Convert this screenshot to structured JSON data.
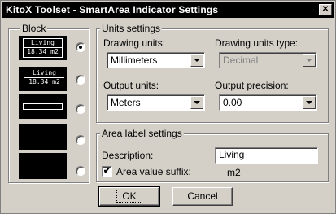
{
  "window": {
    "title": "KitoX Toolset - SmartArea Indicator Settings",
    "close_glyph": "✕"
  },
  "block": {
    "label": "Block",
    "previews": [
      {
        "line1": "Living",
        "line2": "18.34 m2",
        "selected": true
      },
      {
        "line1": "Living",
        "line2": "18.34 m2",
        "selected": false
      },
      {
        "line1": "",
        "line2": "",
        "selected": false
      },
      {
        "line1": "",
        "line2": "",
        "selected": false
      },
      {
        "line1": "",
        "line2": "",
        "selected": false
      }
    ]
  },
  "units": {
    "label": "Units settings",
    "drawing_units_label": "Drawing units:",
    "drawing_units_value": "Millimeters",
    "drawing_units_type_label": "Drawing units type:",
    "drawing_units_type_value": "Decimal",
    "output_units_label": "Output units:",
    "output_units_value": "Meters",
    "output_precision_label": "Output precision:",
    "output_precision_value": "0.00"
  },
  "area_label": {
    "label": "Area label settings",
    "description_label": "Description:",
    "description_value": "Living",
    "suffix_label": "Area value suffix:",
    "suffix_checked_glyph": "✔",
    "suffix_value": "m2"
  },
  "buttons": {
    "ok": "OK",
    "cancel": "Cancel"
  }
}
